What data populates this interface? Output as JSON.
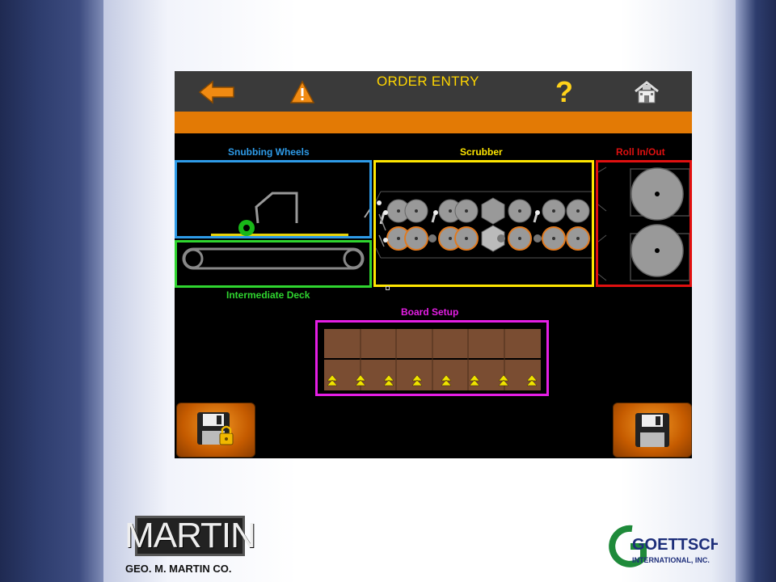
{
  "screen": {
    "title": "ORDER ENTRY",
    "help_glyph": "?",
    "icons": {
      "back": "back-arrow-icon",
      "warning": "warning-icon",
      "help": "help-icon",
      "home": "home-icon"
    },
    "sections": {
      "snubbing_wheels": "Snubbing Wheels",
      "scrubber": "Scrubber",
      "roll_in_out": "Roll In/Out",
      "intermediate_deck": "Intermediate Deck",
      "board_setup": "Board Setup"
    },
    "section_colors": {
      "snubbing_wheels": "#2e9be8",
      "scrubber": "#ffe600",
      "roll_in_out": "#e01010",
      "intermediate_deck": "#2fd52f",
      "board_setup": "#e51ee5"
    },
    "buttons": {
      "save_locked": "save-locked-icon",
      "save": "save-icon"
    }
  },
  "footer": {
    "martin_logo_text": "MARTIN",
    "company_name": "GEO. M. MARTIN CO.",
    "goettsch_logo_text": "GOETTSCH",
    "goettsch_logo_sub": "INTERNATIONAL, INC."
  },
  "colors": {
    "accent_orange": "#e37a05",
    "title_yellow": "#ffd600"
  }
}
